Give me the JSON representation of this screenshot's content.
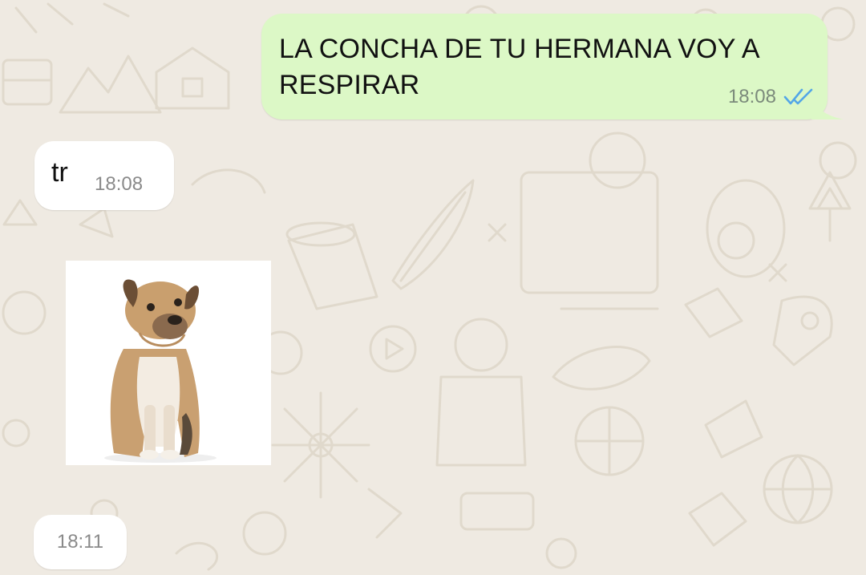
{
  "chat": {
    "wallpaper": "whatsapp-doodle-pattern",
    "colors": {
      "background": "#efeae2",
      "outgoing_bubble": "#dcf8c6",
      "incoming_bubble": "#ffffff",
      "read_ticks": "#53a6e7"
    },
    "messages": [
      {
        "direction": "outgoing",
        "text": "LA CONCHA DE TU HERMANA VOY A RESPIRAR",
        "time": "18:08",
        "status_icon": "double-check-read-icon"
      },
      {
        "direction": "incoming",
        "text": "tr",
        "time": "18:08"
      },
      {
        "direction": "incoming",
        "type": "sticker",
        "sticker_icon": "sad-dog-sticker"
      },
      {
        "direction": "incoming",
        "time": "18:11"
      }
    ]
  }
}
